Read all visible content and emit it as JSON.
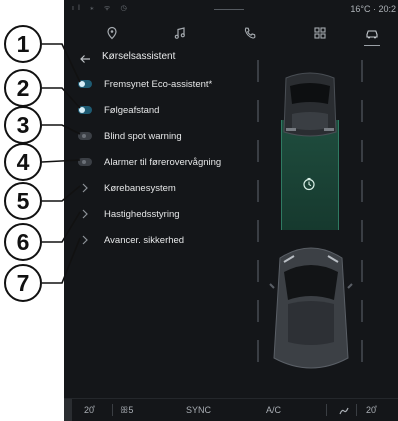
{
  "status_bar": {
    "icons_text": "ıl ⁎ ᯤ ◷",
    "right_text": "16°C · 20:2"
  },
  "top_nav": {
    "tabs": [
      {
        "icon": "map-pin-icon"
      },
      {
        "icon": "music-note-icon"
      },
      {
        "icon": "phone-icon"
      },
      {
        "icon": "apps-grid-icon"
      },
      {
        "icon": "car-icon",
        "active": true
      }
    ]
  },
  "header": {
    "title": "Kørselsassistent"
  },
  "settings": {
    "items": [
      {
        "label": "Fremsynet Eco-assistent*",
        "control": "toggle",
        "on": true
      },
      {
        "label": "Følgeafstand",
        "control": "toggle",
        "on": true
      },
      {
        "label": "Blind spot warning",
        "control": "toggle",
        "on": false
      },
      {
        "label": "Alarmer til førerovervågning",
        "control": "toggle",
        "on": false
      },
      {
        "label": "Kørebanesystem",
        "control": "chevron"
      },
      {
        "label": "Hastighedsstyring",
        "control": "chevron"
      },
      {
        "label": "Avancer. sikkerhed",
        "control": "chevron"
      }
    ]
  },
  "callouts": [
    "1",
    "2",
    "3",
    "4",
    "5",
    "6",
    "7"
  ],
  "bottom_bar": {
    "left_temp": "20̊",
    "fan": "ꕥ5",
    "sync": "SYNC",
    "ac": "A/C",
    "right_temp": "20̊"
  },
  "colors": {
    "screen_bg": "#141619",
    "toggle_on": "#1e5b73",
    "follow_zone": "#1f4d3e"
  }
}
